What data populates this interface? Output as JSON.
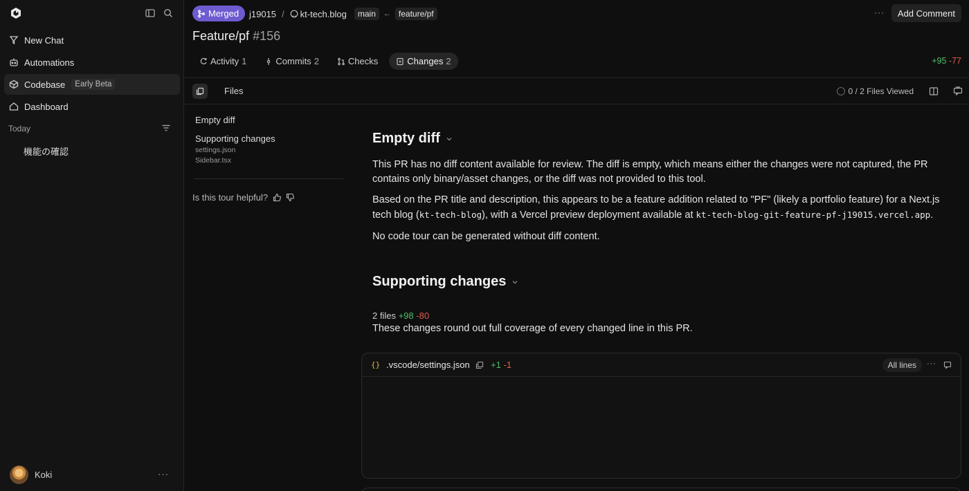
{
  "sidebar": {
    "items": [
      {
        "label": "New Chat",
        "icon": "new-chat-icon"
      },
      {
        "label": "Automations",
        "icon": "automations-icon"
      },
      {
        "label": "Codebase",
        "icon": "codebase-icon",
        "badge": "Early Beta",
        "active": true
      },
      {
        "label": "Dashboard",
        "icon": "dashboard-icon"
      }
    ],
    "section_today": "Today",
    "chats": [
      "機能の確認"
    ],
    "user_name": "Koki"
  },
  "header": {
    "status": "Merged",
    "owner": "j19015",
    "repo": "kt-tech.blog",
    "base_branch": "main",
    "head_branch": "feature/pf",
    "add_comment": "Add Comment",
    "status_color": "#6d5bd0"
  },
  "pr": {
    "title": "Feature/pf",
    "number": "#156"
  },
  "tabs": [
    {
      "label": "Activity",
      "count": "1"
    },
    {
      "label": "Commits",
      "count": "2"
    },
    {
      "label": "Checks",
      "count": ""
    },
    {
      "label": "Changes",
      "count": "2",
      "active": true
    }
  ],
  "diffstat": {
    "add": "+95",
    "del": "-77"
  },
  "toolbar": {
    "files_label": "Files",
    "viewed": "0 / 2 Files Viewed"
  },
  "outline": {
    "empty_diff": "Empty diff",
    "supporting": "Supporting changes",
    "files": [
      "settings.json",
      "Sidebar.tsx"
    ],
    "helpful": "Is this tour helpful?"
  },
  "content": {
    "section1_title": "Empty diff",
    "p1": "This PR has no diff content available for review. The diff is empty, which means either the changes were not captured, the PR contains only binary/asset changes, or the diff was not provided to this tool.",
    "p2_a": "Based on the PR title and description, this appears to be a feature addition related to \"PF\" (likely a portfolio feature) for a Next.js tech blog (",
    "p2_code1": "kt-tech-blog",
    "p2_b": "), with a Vercel preview deployment available at ",
    "p2_code2": "kt-tech-blog-git-feature-pf-j19015.vercel.app",
    "p2_c": ".",
    "p3": "No code tour can be generated without diff content.",
    "section2_title": "Supporting changes",
    "files_summary_prefix": "2 files",
    "files_summary_add": "+98",
    "files_summary_del": "-80",
    "files_summary_text": "These changes round out full coverage of every changed line in this PR."
  },
  "file_card": {
    "name": ".vscode/settings.json",
    "add": "+1",
    "del": "-1",
    "all_lines": "All lines"
  }
}
